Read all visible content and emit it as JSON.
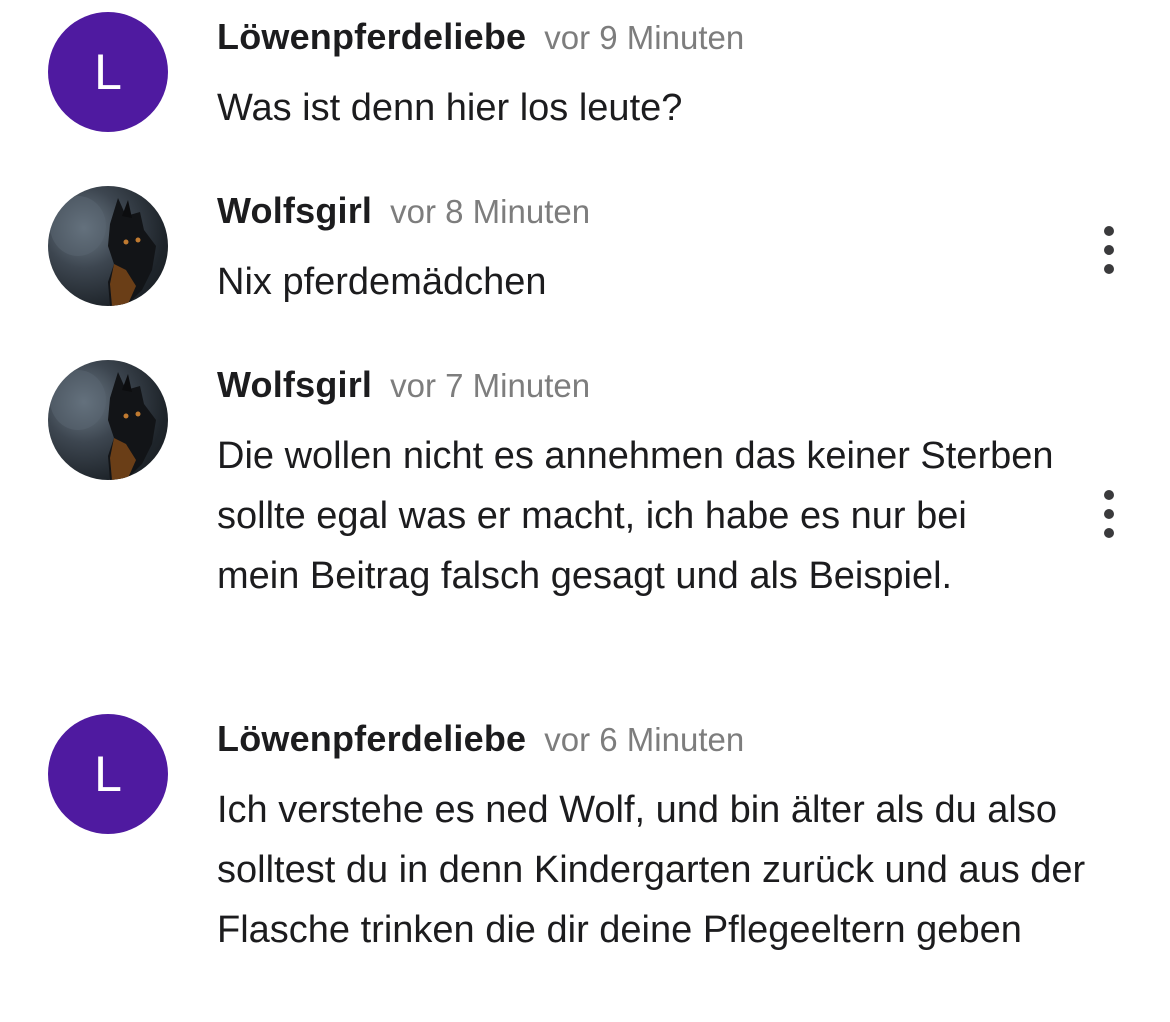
{
  "comments": [
    {
      "avatar": {
        "type": "letter",
        "letter": "L",
        "color": "#4f1aa0"
      },
      "username": "Löwenpferdeliebe",
      "time": "vor 9 Minuten",
      "text": "Was ist denn hier los leute?",
      "has_menu": false
    },
    {
      "avatar": {
        "type": "image",
        "icon": "wolf-avatar"
      },
      "username": "Wolfsgirl",
      "time": "vor 8 Minuten",
      "text": "Nix pferdemädchen",
      "has_menu": true
    },
    {
      "avatar": {
        "type": "image",
        "icon": "wolf-avatar"
      },
      "username": "Wolfsgirl",
      "time": "vor 7 Minuten",
      "text": "Die wollen nicht es annehmen das keiner Sterben sollte egal was er macht, ich habe es nur bei mein Beitrag falsch gesagt und als Beispiel.",
      "has_menu": true
    },
    {
      "avatar": {
        "type": "letter",
        "letter": "L",
        "color": "#4f1aa0"
      },
      "username": "Löwenpferdeliebe",
      "time": "vor 6 Minuten",
      "text": "Ich verstehe es ned Wolf, und bin älter als du also solltest du in denn Kindergarten zurück und aus der Flasche trinken die dir deine Pflegeeltern geben",
      "has_menu": false
    }
  ],
  "colors": {
    "text": "#1c1c1e",
    "timestamp": "#7d7d7d",
    "menu_dots": "#3a3a3c",
    "avatar_letter_bg": "#4f1aa0"
  }
}
